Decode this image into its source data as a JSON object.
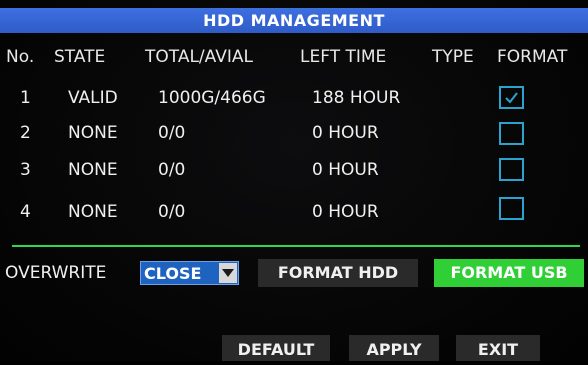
{
  "title": "HDD MANAGEMENT",
  "table": {
    "headers": {
      "no": "No.",
      "state": "STATE",
      "total": "TOTAL/AVIAL",
      "left_time": "LEFT TIME",
      "type": "TYPE",
      "format": "FORMAT"
    },
    "rows": [
      {
        "no": "1",
        "state": "VALID",
        "total": "1000G/466G",
        "left_time": "188 HOUR",
        "type": "",
        "format_checked": true
      },
      {
        "no": "2",
        "state": "NONE",
        "total": "0/0",
        "left_time": "0 HOUR",
        "type": "",
        "format_checked": false
      },
      {
        "no": "3",
        "state": "NONE",
        "total": "0/0",
        "left_time": "0 HOUR",
        "type": "",
        "format_checked": false
      },
      {
        "no": "4",
        "state": "NONE",
        "total": "0/0",
        "left_time": "0 HOUR",
        "type": "",
        "format_checked": false
      }
    ]
  },
  "overwrite": {
    "label": "OVERWRITE",
    "selected": "CLOSE"
  },
  "buttons": {
    "format_hdd": "FORMAT HDD",
    "format_usb": "FORMAT USB",
    "default": "DEFAULT",
    "apply": "APPLY",
    "exit": "EXIT"
  },
  "colors": {
    "title_bar": "#3567d6",
    "divider": "#2fd84a",
    "highlight_button": "#2fcf35",
    "checkbox_border": "#2aa4cf",
    "select_bg": "#1f63c0"
  },
  "icons": {
    "checkbox_checked": "check-icon",
    "dropdown": "chevron-down-icon"
  }
}
